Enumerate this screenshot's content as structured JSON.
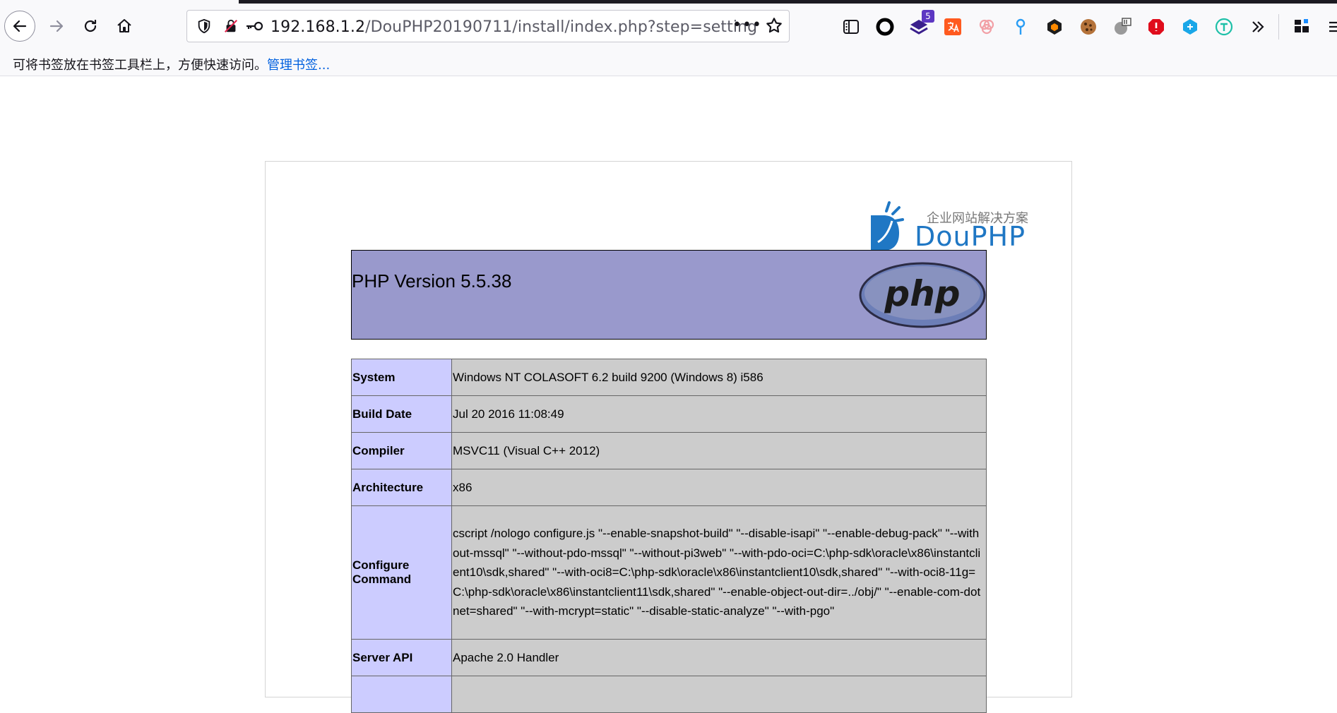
{
  "browser": {
    "url": {
      "host": "192.168.1.2",
      "path": "/DouPHP20190711/install/index.php?step=setting"
    },
    "more_label": "•••",
    "extensions": [
      {
        "name": "reader-view-icon"
      },
      {
        "name": "circle-extension-icon"
      },
      {
        "name": "layers-extension-icon",
        "badge": "5"
      },
      {
        "name": "translate-extension-icon"
      },
      {
        "name": "rings-extension-icon"
      },
      {
        "name": "pin-extension-icon"
      },
      {
        "name": "box-extension-icon"
      },
      {
        "name": "cookie-extension-icon"
      },
      {
        "name": "snowflake-extension-icon"
      },
      {
        "name": "shield-red-extension-icon"
      },
      {
        "name": "cube-extension-icon"
      },
      {
        "name": "t-circle-extension-icon"
      }
    ],
    "bookmarks_bar": {
      "message": "可将书签放在书签工具栏上，方便快速访问。",
      "link": "管理书签..."
    }
  },
  "page": {
    "logo": {
      "tagline": "企业网站解决方案",
      "word": "DouPHP"
    },
    "php_header": {
      "version": "PHP Version 5.5.38",
      "logo_text": "php"
    },
    "info_rows": [
      {
        "key": "System",
        "value": "Windows NT COLASOFT 6.2 build 9200 (Windows 8) i586"
      },
      {
        "key": "Build Date",
        "value": "Jul 20 2016 11:08:49"
      },
      {
        "key": "Compiler",
        "value": "MSVC11 (Visual C++ 2012)"
      },
      {
        "key": "Architecture",
        "value": "x86"
      },
      {
        "key": "Configure Command",
        "value": "cscript /nologo configure.js \"--enable-snapshot-build\" \"--disable-isapi\" \"--enable-debug-pack\" \"--without-mssql\" \"--without-pdo-mssql\" \"--without-pi3web\" \"--with-pdo-oci=C:\\php-sdk\\oracle\\x86\\instantclient10\\sdk,shared\" \"--with-oci8=C:\\php-sdk\\oracle\\x86\\instantclient10\\sdk,shared\" \"--with-oci8-11g=C:\\php-sdk\\oracle\\x86\\instantclient11\\sdk,shared\" \"--enable-object-out-dir=../obj/\" \"--enable-com-dotnet=shared\" \"--with-mcrypt=static\" \"--disable-static-analyze\" \"--with-pgo\""
      },
      {
        "key": "Server API",
        "value": "Apache 2.0 Handler"
      }
    ]
  },
  "colors": {
    "php_header_bg": "#9999cc",
    "key_cell_bg": "#ccccff",
    "value_cell_bg": "#cccccc",
    "link": "#0060df",
    "logo_blue": "#1f77c4"
  }
}
